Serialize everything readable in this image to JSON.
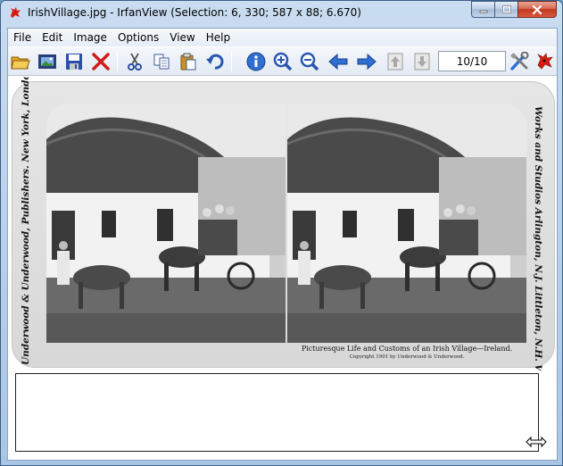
{
  "window": {
    "title": "IrishVillage.jpg - IrfanView (Selection: 6, 330; 587 x 88; 6.670)"
  },
  "menu": [
    "File",
    "Edit",
    "Image",
    "Options",
    "View",
    "Help"
  ],
  "toolbar": {
    "page_counter": "10/10",
    "buttons": [
      "open-folder-icon",
      "slideshow-icon",
      "save-icon",
      "delete-icon",
      "cut-icon",
      "copy-icon",
      "paste-icon",
      "undo-icon",
      "info-icon",
      "zoom-in-icon",
      "zoom-out-icon",
      "previous-icon",
      "next-icon",
      "page-up-icon",
      "page-down-icon",
      "settings-icon",
      "irfanview-logo-icon"
    ]
  },
  "image": {
    "left_vertical_text": "Underwood & Underwood, Publishers. New York, London, Toronto-Canada, Ottawa-Kansas.",
    "right_vertical_text": "Works and Studios Arlington, N.J. Littleton, N.H. Washington, D.C.",
    "caption": "Picturesque Life and Customs of an Irish Village—Ireland.",
    "copyright": "Copyright 1901 by Underwood & Underwood."
  },
  "colors": {
    "titlebar": "#b9d1ea",
    "accent_close": "#c2391f"
  }
}
